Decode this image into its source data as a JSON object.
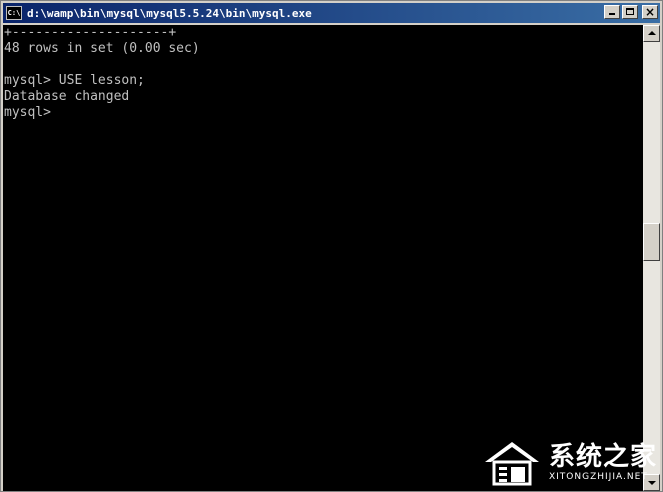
{
  "window": {
    "title": "d:\\wamp\\bin\\mysql\\mysql5.5.24\\bin\\mysql.exe",
    "icon_label": "C:\\"
  },
  "console": {
    "lines": [
      "+--------------------+",
      "48 rows in set (0.00 sec)",
      "",
      "mysql> USE lesson;",
      "Database changed",
      "mysql>"
    ]
  },
  "caption_buttons": {
    "close_glyph": "×"
  },
  "watermark": {
    "brand": "系统之家",
    "url": "XITONGZHIJIA.NET"
  },
  "colors": {
    "console_text": "#c0c0c0",
    "console_bg": "#000000",
    "title_bar": "#0a246a"
  }
}
